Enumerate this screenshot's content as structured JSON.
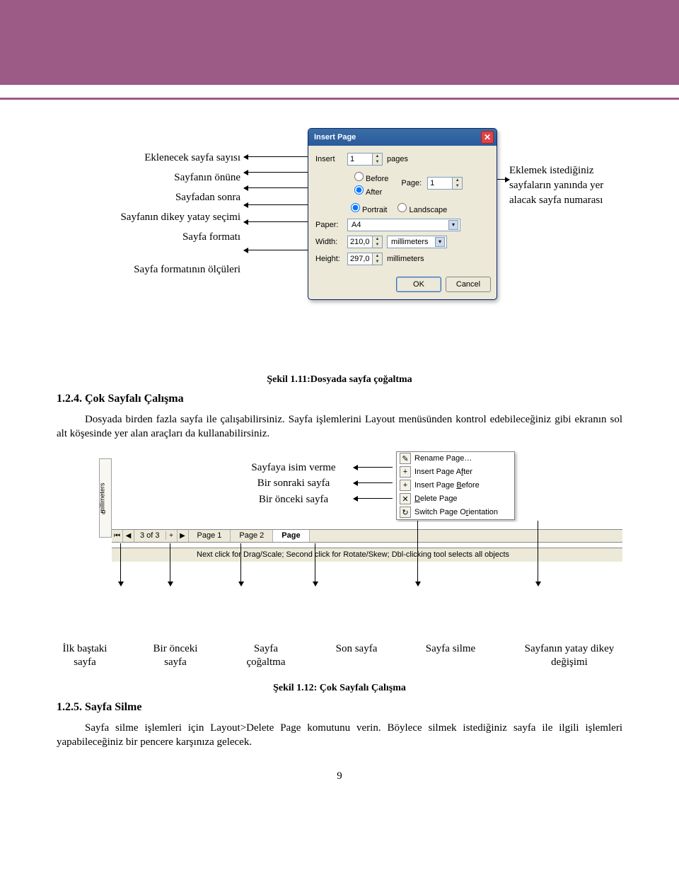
{
  "top_annotations": {
    "left": [
      "Eklenecek sayfa sayısı",
      "Sayfanın önüne",
      "Sayfadan sonra",
      "Sayfanın dikey yatay seçimi",
      "Sayfa formatı",
      "Sayfa formatının ölçüleri"
    ],
    "right": "Eklemek istediğiniz sayfaların yanında yer alacak sayfa numarası"
  },
  "dialog": {
    "title": "Insert Page",
    "insert_label": "Insert",
    "insert_value": "1",
    "pages_word": "pages",
    "before": "Before",
    "after": "After",
    "page_label": "Page:",
    "page_value": "1",
    "portrait": "Portrait",
    "landscape": "Landscape",
    "paper_label": "Paper:",
    "paper_value": "A4",
    "width_label": "Width:",
    "width_value": "210,0",
    "height_label": "Height:",
    "height_value": "297,0",
    "unit_mm": "millimeters",
    "ok": "OK",
    "cancel": "Cancel"
  },
  "caption1": "Şekil 1.11:Dosyada sayfa çoğaltma",
  "section1_title": "1.2.4. Çok Sayfalı Çalışma",
  "section1_body": "Dosyada birden fazla sayfa ile çalışabilirsiniz. Sayfa işlemlerini Layout menüsünden kontrol edebileceğiniz gibi ekranın sol alt köşesinde yer alan araçları da kullanabilirsiniz.",
  "mid_labels": [
    "Sayfaya isim verme",
    "Bir sonraki sayfa",
    "Bir önceki sayfa"
  ],
  "context_menu": {
    "rename": "Rename Page…",
    "insert_after": "Insert Page After",
    "insert_before": "Insert Page Before",
    "delete": "Delete Page",
    "switch": "Switch Page Orientation",
    "after_u": "f",
    "before_u": "B"
  },
  "ruler_unit": "millimeters",
  "ruler_zero": "0",
  "page_bar": {
    "counter": "3 of 3",
    "page1": "Page 1",
    "page2": "Page 2",
    "page_cut": "Page"
  },
  "status_text": "Next click for Drag/Scale; Second click for Rotate/Skew; Dbl-clicking tool selects all objects",
  "bottom_labels": {
    "first_page": "İlk baştaki sayfa",
    "prev_page": "Bir önceki sayfa",
    "duplicate": "Sayfa çoğaltma",
    "last_page": "Son sayfa",
    "delete_page": "Sayfa silme",
    "orientation": "Sayfanın yatay dikey değişimi"
  },
  "caption2": "Şekil 1.12: Çok Sayfalı Çalışma",
  "section2_title": "1.2.5. Sayfa Silme",
  "section2_body": "Sayfa silme işlemleri için Layout>Delete Page komutunu verin. Böylece silmek istediğiniz sayfa ile ilgili işlemleri yapabileceğiniz bir pencere karşınıza gelecek.",
  "page_number": "9"
}
